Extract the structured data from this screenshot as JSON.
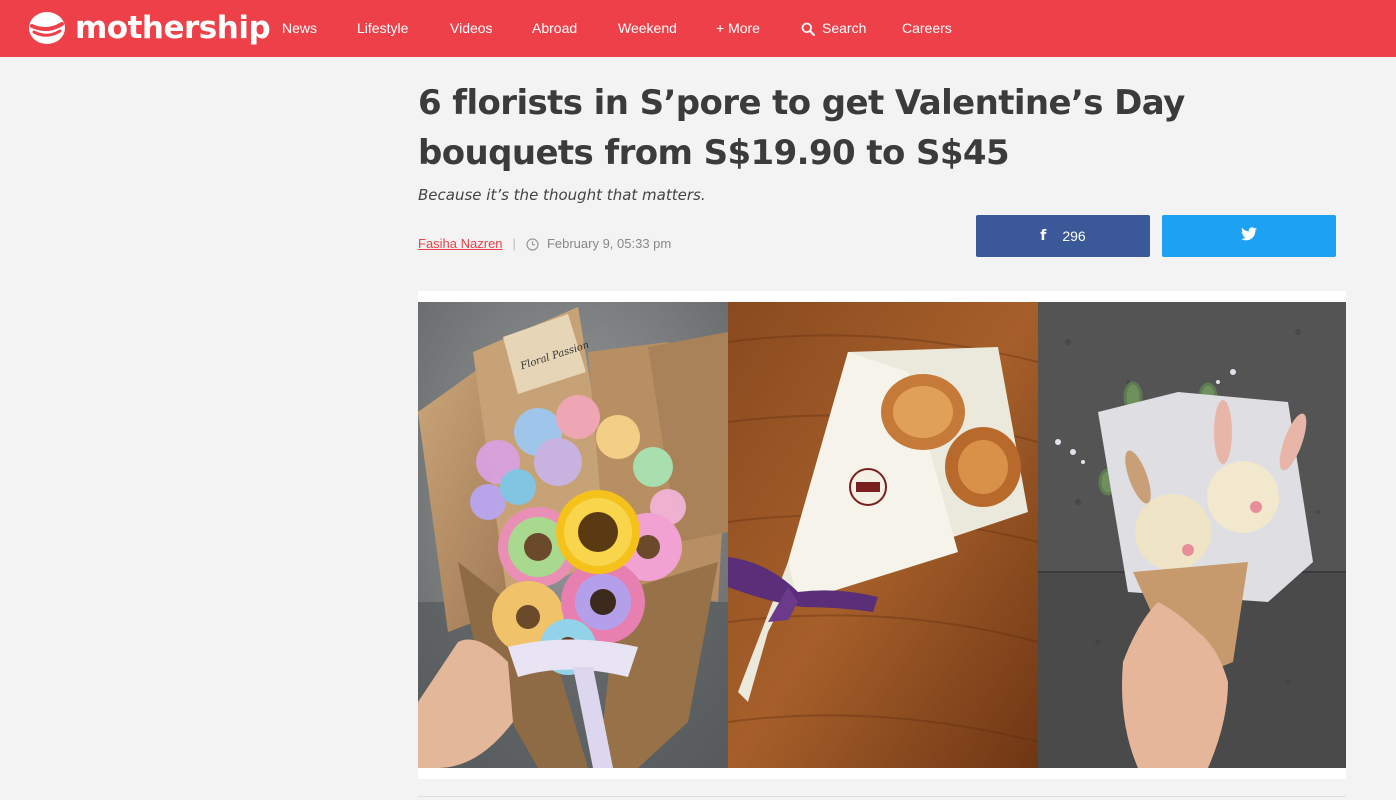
{
  "site": {
    "name": "mothership",
    "brand_color": "#ee4049"
  },
  "nav": {
    "items": [
      {
        "label": "News"
      },
      {
        "label": "Lifestyle"
      },
      {
        "label": "Videos"
      },
      {
        "label": "Abroad"
      },
      {
        "label": "Weekend"
      },
      {
        "label": "+ More"
      },
      {
        "label": "Search",
        "icon": "search-icon"
      },
      {
        "label": "Careers"
      }
    ]
  },
  "article": {
    "title": "6 florists in S’pore to get Valentine’s Day bouquets from S$19.90 to S$45",
    "subtitle": "Because it’s the thought that matters.",
    "author": "Fasiha Nazren",
    "separator": "|",
    "date": "February 9, 05:33 pm"
  },
  "share": {
    "facebook": {
      "icon": "facebook-icon",
      "count": "296",
      "color": "#3b5998"
    },
    "twitter": {
      "icon": "twitter-icon",
      "color": "#1da1f2"
    }
  },
  "hero_image": {
    "panels": [
      {
        "description_icon": "rainbow-bouquet-photo",
        "label_on_tag": "Floral Passion"
      },
      {
        "description_icon": "pastry-bouquet-photo"
      },
      {
        "description_icon": "bunny-bouquet-photo"
      }
    ]
  }
}
